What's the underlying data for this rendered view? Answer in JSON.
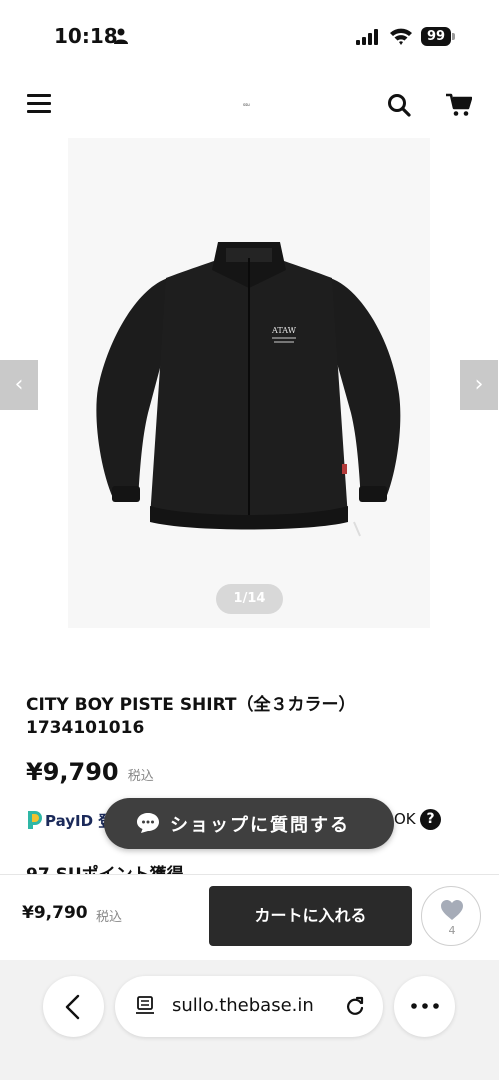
{
  "status_bar": {
    "time": "10:18",
    "battery": "99",
    "icons": [
      "person-icon",
      "signal-icon",
      "wifi-icon",
      "battery-icon"
    ]
  },
  "header": {
    "logo_text": "ssu",
    "icons": [
      "menu-icon",
      "search-icon",
      "cart-icon"
    ]
  },
  "gallery": {
    "page_indicator": "1/14",
    "prev_label": "‹",
    "next_label": "›",
    "print_text": "ATAW"
  },
  "product": {
    "name": "CITY BOY PISTE SHIRT（全３カラー）",
    "code": "1734101016",
    "price": "¥9,790",
    "tax_label": "税込"
  },
  "payid": {
    "brand": "PayID",
    "text_visible": "PayID 登",
    "ok_text": "OK",
    "help_label": "?"
  },
  "chat": {
    "label": "ショップに質問する"
  },
  "points": {
    "text": "97 SUポイント獲得"
  },
  "buy_bar": {
    "price": "¥9,790",
    "tax_label": "税込",
    "cart_label": "カートに入れる",
    "favorite_count": "4"
  },
  "browser": {
    "url": "sullo.thebase.in",
    "icons": [
      "back-icon",
      "page-icon",
      "reload-icon",
      "more-icon"
    ]
  }
}
